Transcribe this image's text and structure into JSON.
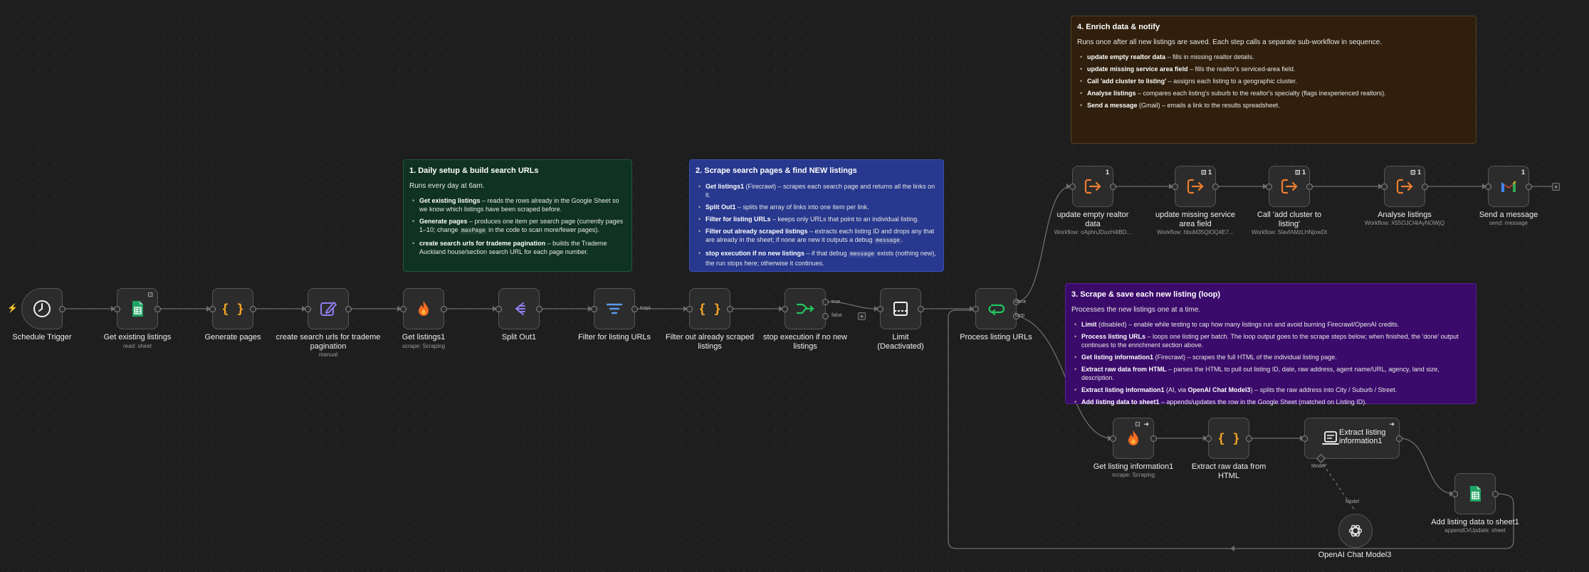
{
  "colors": {
    "canvas": "#1e1e1e",
    "note_green": "#0f3222",
    "note_blue": "#27388e",
    "note_purple": "#3b0b6b",
    "note_brown": "#2f1f0c",
    "accent_orange": "#e8742f"
  },
  "notes": {
    "setup": {
      "title": "1. Daily setup & build search URLs",
      "intro": "Runs every day at 6am.",
      "items": [
        {
          "bold": "Get existing listings",
          "text": " – reads the rows already in the Google Sheet so we know which listings have been scraped before."
        },
        {
          "bold": "Generate pages",
          "text": " – produces one item per search page (currently pages 1–10; change ",
          "code": "maxPage",
          "text2": " in the code to scan more/fewer pages)."
        },
        {
          "bold": "create search urls for trademe pagination",
          "text": " – builds the Trademe Auckland house/section search URL for each page number."
        }
      ]
    },
    "scrape": {
      "title": "2. Scrape search pages & find NEW listings",
      "items": [
        {
          "bold": "Get listings1",
          "text": " (Firecrawl) – scrapes each search page and returns all the links on it."
        },
        {
          "bold": "Split Out1",
          "text": " – splits the array of links into one item per link."
        },
        {
          "bold": "Filter for listing URLs",
          "text": " – keeps only URLs that point to an individual listing."
        },
        {
          "bold": "Filter out already scraped listings",
          "text": " – extracts each listing ID and drops any that are already in the sheet; if none are new it outputs a debug ",
          "code": "message",
          "text2": "."
        },
        {
          "bold": "stop execution if no new listings",
          "text": " – if that debug ",
          "code": "message",
          "text2": " exists (nothing new), the run stops here; otherwise it continues."
        }
      ]
    },
    "loop": {
      "title": "3. Scrape & save each new listing (loop)",
      "intro": "Processes the new listings one at a time.",
      "items": [
        {
          "bold": "Limit",
          "text": " (disabled) – enable while testing to cap how many listings run and avoid burning Firecrawl/OpenAI credits."
        },
        {
          "bold": "Process listing URLs",
          "text": " – loops one listing per batch. The loop output goes to the scrape steps below; when finished, the 'done' output continues to the enrichment section above."
        },
        {
          "bold": "Get listing information1",
          "text": " (Firecrawl) – scrapes the full HTML of the individual listing page."
        },
        {
          "bold": "Extract raw data from HTML",
          "text": " – parses the HTML to pull out listing ID, date, raw address, agent name/URL, agency, land size, description."
        },
        {
          "bold": "Extract listing information1",
          "text": " (AI, via ",
          "bold2": "OpenAI Chat Model3",
          "text2": ") – splits the raw address into City / Suburb / Street."
        },
        {
          "bold": "Add listing data to sheet1",
          "text": " – appends/updates the row in the Google Sheet (matched on Listing ID)."
        }
      ]
    },
    "enrich": {
      "title": "4. Enrich data & notify",
      "intro": "Runs once after all new listings are saved. Each step calls a separate sub-workflow in sequence.",
      "items": [
        {
          "bold": "update empty realtor data",
          "text": " – fills in missing realtor details."
        },
        {
          "bold": "update missing service area field",
          "text": " – fills the realtor's serviced-area field."
        },
        {
          "bold": "Call 'add cluster to listing'",
          "text": " – assigns each listing to a geographic cluster."
        },
        {
          "bold": "Analyse listings",
          "text": " – compares each listing's suburb to the realtor's specialty (flags inexperienced realtors)."
        },
        {
          "bold": "Send a message",
          "text": " (Gmail) – emails a link to the results spreadsheet."
        }
      ]
    }
  },
  "nodes": {
    "schedule_trigger": {
      "label": "Schedule Trigger"
    },
    "get_existing": {
      "label": "Get existing listings",
      "sub": "read: sheet"
    },
    "generate_pages": {
      "label": "Generate pages"
    },
    "create_urls": {
      "label": "create search urls for trademe pagination",
      "sub": "manual"
    },
    "get_listings1": {
      "label": "Get listings1",
      "sub": "scrape: Scraping"
    },
    "split_out1": {
      "label": "Split Out1"
    },
    "filter_urls": {
      "label": "Filter for listing URLs"
    },
    "filter_scraped": {
      "label": "Filter out already scraped listings"
    },
    "stop_exec": {
      "label": "stop execution if no new listings"
    },
    "limit": {
      "label": "Limit (Deactivated)"
    },
    "process_urls": {
      "label": "Process listing URLs"
    },
    "update_realtor": {
      "label": "update empty realtor data",
      "sub": "Workflow: oAphnJDuxH4lBD...",
      "badge": "1"
    },
    "update_service": {
      "label": "update missing service area field",
      "sub": "Workflow: hbuM35QlOQ4E7...",
      "badge": "1"
    },
    "call_cluster": {
      "label": "Call 'add cluster to listing'",
      "sub": "Workflow: 5lavfAMzLHNjowDt",
      "badge": "1"
    },
    "analyse": {
      "label": "Analyse listings",
      "sub": "Workflow: X55OJCl4iAyNOWjQ",
      "badge": "1"
    },
    "send_message": {
      "label": "Send a message",
      "sub": "send: message",
      "badge": "1"
    },
    "get_listing_info1": {
      "label": "Get listing information1",
      "sub": "scrape: Scraping"
    },
    "extract_raw": {
      "label": "Extract raw data from HTML"
    },
    "extract_listing": {
      "label": "Extract listing information1"
    },
    "add_sheet": {
      "label": "Add listing data to sheet1",
      "sub": "appendOrUpdate: sheet"
    },
    "openai": {
      "label": "OpenAI Chat Model3"
    }
  },
  "edge_labels": {
    "kept": "Kept",
    "true": "true",
    "false": "false",
    "done": "done",
    "loop": "loop",
    "model_port": "Model*",
    "model": "Model"
  },
  "icons": {
    "schedule_trigger": "clock-icon",
    "get_existing": "google-sheets-icon",
    "generate_pages": "code-braces-icon",
    "create_urls": "edit-pencil-icon",
    "get_listings1": "firecrawl-flame-icon",
    "split_out1": "split-out-icon",
    "filter_urls": "filter-icon",
    "filter_scraped": "code-braces-icon",
    "stop_exec": "if-branch-icon",
    "limit": "limit-icon",
    "process_urls": "loop-icon",
    "execute_workflow": "execute-workflow-icon",
    "send_message": "gmail-icon",
    "extract_listing": "ai-information-extractor-icon",
    "openai": "openai-icon"
  }
}
